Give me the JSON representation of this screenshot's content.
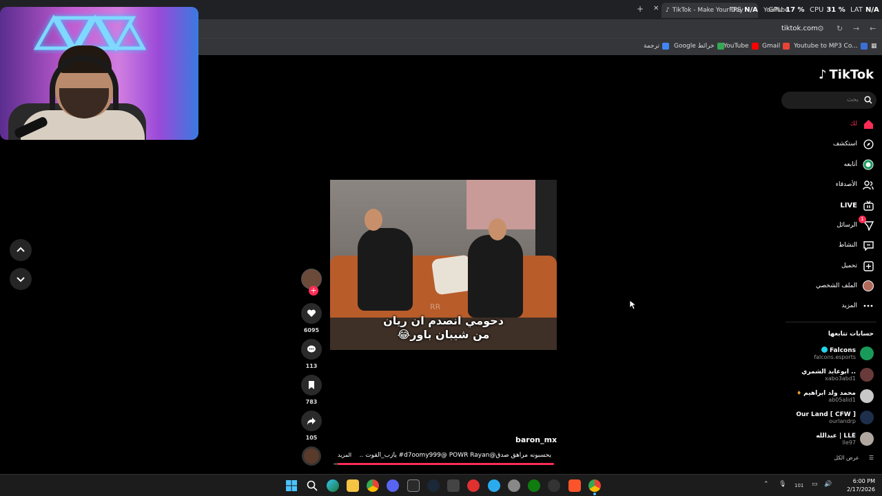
{
  "browser": {
    "tabs": [
      {
        "label": "TikTok - Make Your Day",
        "active": true
      },
      {
        "label": "YouTube",
        "active": false
      }
    ],
    "new_tab": "+",
    "url": "tiktok.com",
    "bookmarks": [
      {
        "label": "Youtube to MP3 Co...",
        "color": "#3b6fd6"
      },
      {
        "label": "Gmail",
        "color": "#ea4335"
      },
      {
        "label": "YouTube",
        "color": "#ff0000"
      },
      {
        "label": "Google خرائط",
        "color": "#34a853"
      },
      {
        "label": "ترجمة",
        "color": "#4285f4"
      }
    ]
  },
  "perf_overlay": {
    "fps_label": "FPS",
    "fps_value": "N/A",
    "gpu_label": "GPU",
    "gpu_value": "17 %",
    "cpu_label": "CPU",
    "cpu_value": "31 %",
    "lat_label": "LAT",
    "lat_value": "N/A"
  },
  "tiktok": {
    "logo": "TikTok",
    "search_placeholder": "بحث",
    "nav": [
      {
        "label": "لك",
        "icon": "home-icon",
        "active": true
      },
      {
        "label": "استكشف",
        "icon": "compass-icon"
      },
      {
        "label": "أتابعه",
        "icon": "following-icon"
      },
      {
        "label": "الأصدقاء",
        "icon": "friends-icon"
      },
      {
        "label": "LIVE",
        "icon": "live-icon"
      },
      {
        "label": "الرسائل",
        "icon": "messages-icon",
        "badge": "1"
      },
      {
        "label": "النشاط",
        "icon": "activity-icon"
      },
      {
        "label": "تحميل",
        "icon": "upload-icon"
      },
      {
        "label": "الملف الشخصي",
        "icon": "profile-icon"
      },
      {
        "label": "المزيد",
        "icon": "more-icon"
      }
    ],
    "following_title": "حسابات تتابعها",
    "following": [
      {
        "name": "Falcons",
        "handle": "falcons.esports",
        "verified": true,
        "color": "#1a9a5a"
      },
      {
        "name": "ابوعابد الشمري ..",
        "handle": "xabo3abd1",
        "color": "#6a3a3a"
      },
      {
        "name": "محمد ولد ابراهيم",
        "handle": "ab05alid1",
        "color": "#c8c8c8"
      },
      {
        "name": "Our Land [ CFW ]",
        "handle": "ourlandrp",
        "color": "#1d2f4a"
      },
      {
        "name": "عبدالله | LLE",
        "handle": "lle97",
        "color": "#b0a8a0"
      }
    ],
    "see_all": "عرض الكل",
    "video": {
      "caption_line1": "دحومي انصدم ان ريان",
      "caption_line2": "من شيبان باور😂",
      "watermark": "RR",
      "author": "baron_mx",
      "description": "يحسبونه مراهق صدق@d7oomy999@ POWR Rayan# يازب_القوت ...",
      "more": "المزيد",
      "progress": 0.98
    },
    "actions": {
      "likes": "6095",
      "comments": "113",
      "saves": "783",
      "shares": "105"
    }
  },
  "taskbar": {
    "time": "6:00 PM",
    "date": "2/17/2026",
    "tray_num": "101"
  },
  "colors": {
    "accent": "#fe2c55",
    "background": "#000000",
    "browser_bar": "#35363a"
  }
}
